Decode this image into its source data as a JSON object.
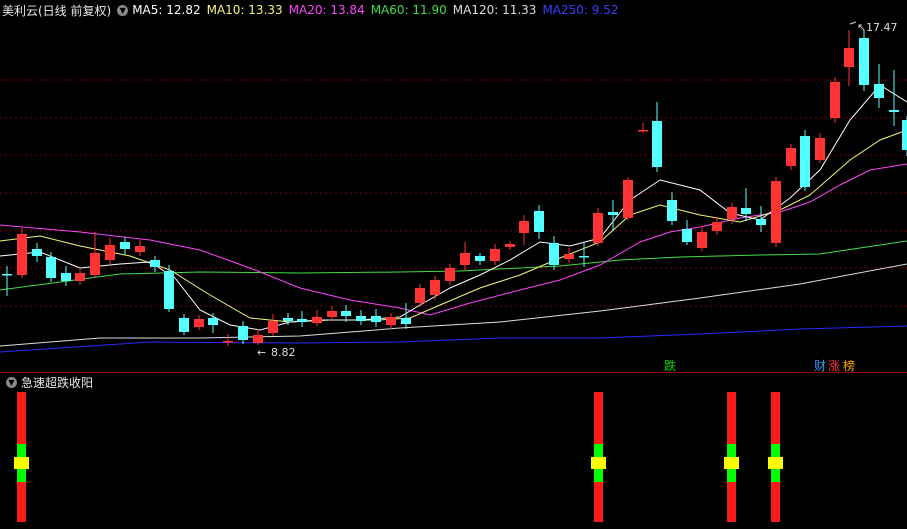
{
  "header": {
    "title": "美利云(日线 前复权)",
    "ma_items": [
      {
        "label": "MA5: 12.82",
        "color": "#ffffff"
      },
      {
        "label": "MA10: 13.33",
        "color": "#f5f57a"
      },
      {
        "label": "MA20: 13.84",
        "color": "#ff44ff"
      },
      {
        "label": "MA60: 11.90",
        "color": "#44dd44"
      },
      {
        "label": "MA120: 11.33",
        "color": "#dddddd"
      },
      {
        "label": "MA250: 9.52",
        "color": "#3a3aff"
      }
    ]
  },
  "annotations": {
    "high_label": "17.47",
    "low_label": "8.82"
  },
  "event_tags": {
    "die": "跌",
    "cai": "财",
    "zhang": "涨",
    "bang": "榜"
  },
  "indicator": {
    "title": "急速超跌收阳"
  },
  "colors": {
    "up": "#ff3333",
    "down": "#54ffff",
    "grid": "#7a0000",
    "signal_red": "#ff1a1a",
    "signal_green": "#00ff00",
    "signal_yellow": "#ffff00"
  }
}
